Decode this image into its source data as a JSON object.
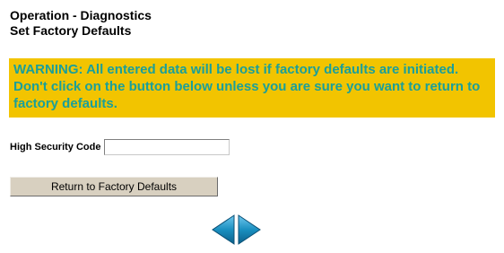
{
  "header": {
    "line1": "Operation - Diagnostics",
    "line2": "Set Factory Defaults"
  },
  "warning": {
    "text": "WARNING: All entered data will be lost if factory defaults are initiated. Don't click on the button below unless you are sure you want to return to factory defaults.",
    "background_color": "#f2c400",
    "text_color": "#1a9f9a"
  },
  "security": {
    "label": "High Security Code",
    "value": ""
  },
  "actions": {
    "factory_defaults_label": "Return to Factory Defaults"
  },
  "navigation": {
    "back_icon": "left-triangle-arrow",
    "forward_icon": "right-triangle-arrow",
    "arrow_color": "#1a8fc0"
  }
}
